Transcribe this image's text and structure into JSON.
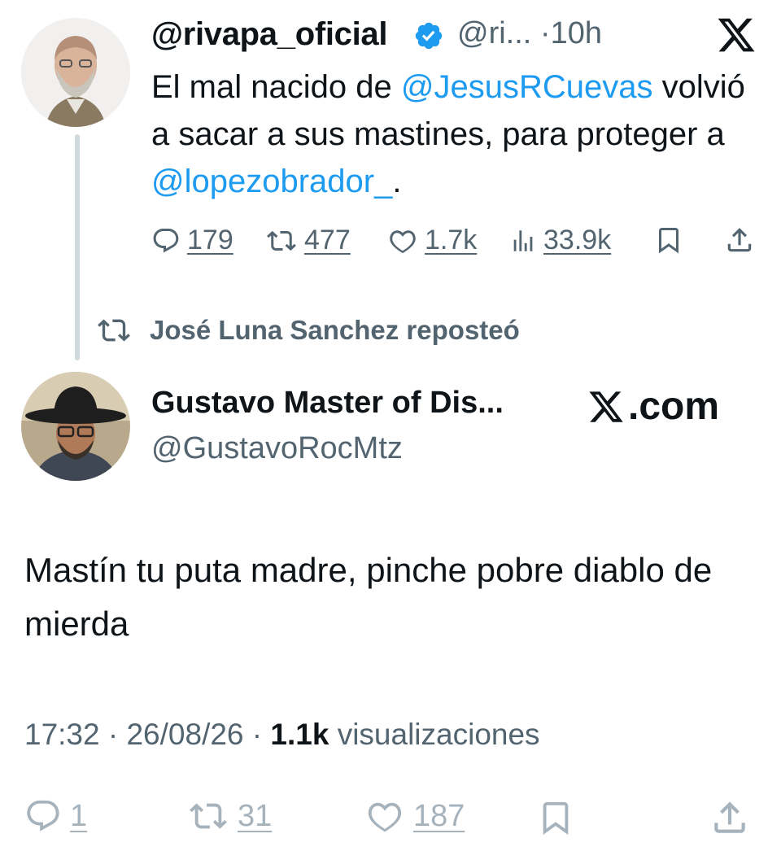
{
  "tweet1": {
    "display_name": "@rivapa_oficial",
    "handle": "@ri...",
    "sep": "·",
    "time": "10h",
    "text_1": "El mal nacido de ",
    "mention_1": "@JesusRCuevas",
    "text_2": " volvió a sacar a sus mastines, para proteger a ",
    "mention_2": "@lopezobrador_",
    "text_3": ".",
    "replies": "179",
    "reposts": "477",
    "likes": "1.7k",
    "views": "33.9k"
  },
  "repost_banner": {
    "text": "José Luna Sanchez reposteó"
  },
  "tweet2": {
    "display_name": "Gustavo Master of Dis...",
    "handle": "@GustavoRocMtz",
    "brand": ".com",
    "text": "Mastín tu puta madre,  pinche pobre diablo de mierda",
    "time": "17:32",
    "sep": " · ",
    "date": "26/08/26",
    "views_count": "1.1k",
    "views_label": "visualizaciones",
    "replies": "1",
    "reposts": "31",
    "likes": "187"
  },
  "colors": {
    "accent": "#1d9bf0",
    "muted": "#536471",
    "faint": "#a6b3bd",
    "thread": "#cfd9de"
  }
}
